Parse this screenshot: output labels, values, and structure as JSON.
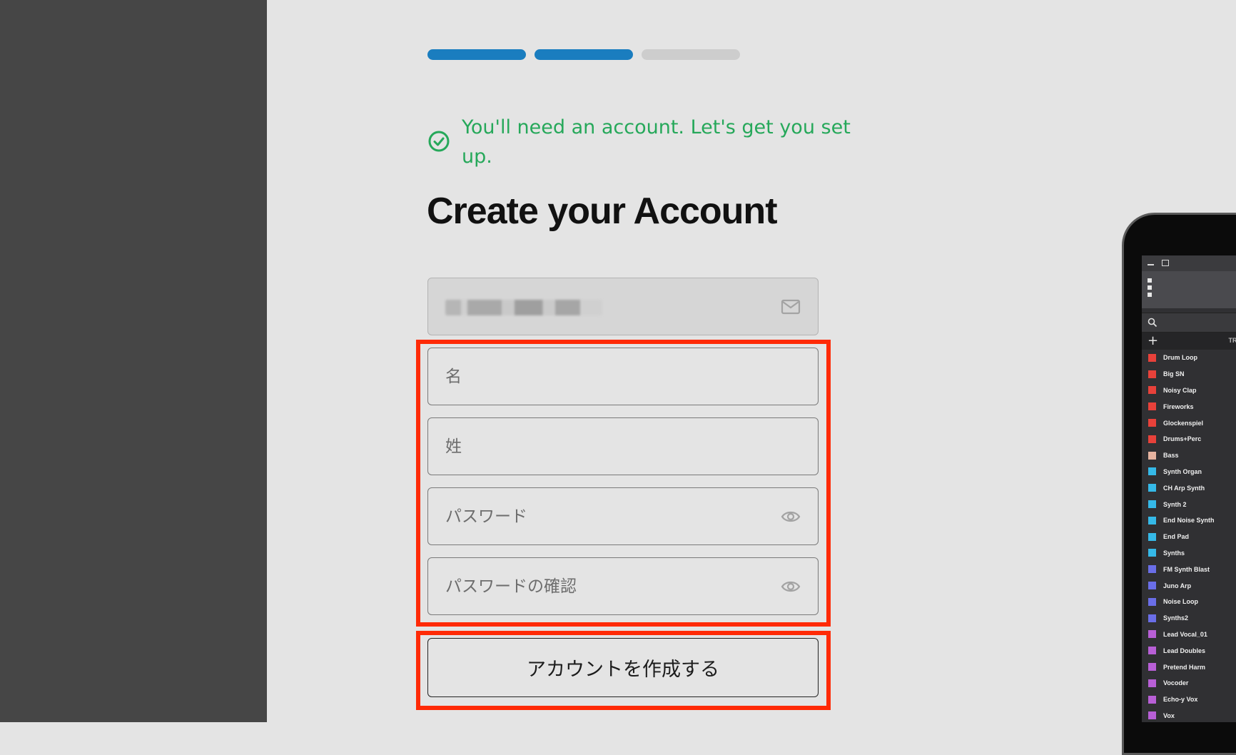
{
  "progress": {
    "total_steps": 3,
    "completed_steps": 2,
    "active_color": "#1a7dbf",
    "inactive_color": "#cdcdcd"
  },
  "notice": {
    "text": "You'll need an account. Let's get you set up.",
    "color": "#26a85a"
  },
  "form": {
    "title": "Create your Account",
    "email": {
      "value": "",
      "obscured": true,
      "icon": "mail-icon"
    },
    "first_name": {
      "placeholder": "名"
    },
    "last_name": {
      "placeholder": "姓"
    },
    "password": {
      "placeholder": "パスワード",
      "icon": "eye-icon"
    },
    "password_confirm": {
      "placeholder": "パスワードの確認",
      "icon": "eye-icon"
    },
    "submit_label": "アカウントを作成する"
  },
  "highlight_color": "#ff2a06",
  "daw_preview": {
    "header_label": "TRA",
    "tracks": [
      {
        "name": "Drum Loop",
        "color": "#e8413a"
      },
      {
        "name": "Big SN",
        "color": "#e8413a"
      },
      {
        "name": "Noisy Clap",
        "color": "#e8413a"
      },
      {
        "name": "Fireworks",
        "color": "#e8413a"
      },
      {
        "name": "Glockenspiel",
        "color": "#e8413a"
      },
      {
        "name": "Drums+Perc",
        "color": "#e8413a"
      },
      {
        "name": "Bass",
        "color": "#e6b3a0"
      },
      {
        "name": "Synth Organ",
        "color": "#35b9e8"
      },
      {
        "name": "CH Arp Synth",
        "color": "#35b9e8"
      },
      {
        "name": "Synth 2",
        "color": "#35b9e8"
      },
      {
        "name": "End Noise Synth",
        "color": "#35b9e8"
      },
      {
        "name": "End Pad",
        "color": "#35b9e8"
      },
      {
        "name": "Synths",
        "color": "#35b9e8"
      },
      {
        "name": "FM Synth Blast",
        "color": "#6a6ee8"
      },
      {
        "name": "Juno Arp",
        "color": "#6a6ee8"
      },
      {
        "name": "Noise Loop",
        "color": "#6a6ee8"
      },
      {
        "name": "Synths2",
        "color": "#6a6ee8"
      },
      {
        "name": "Lead Vocal_01",
        "color": "#b85fd6"
      },
      {
        "name": "Lead Doubles",
        "color": "#b85fd6"
      },
      {
        "name": "Pretend Harm",
        "color": "#b85fd6"
      },
      {
        "name": "Vocoder",
        "color": "#b85fd6"
      },
      {
        "name": "Echo-y Vox",
        "color": "#b85fd6"
      },
      {
        "name": "Vox",
        "color": "#b85fd6"
      }
    ]
  }
}
